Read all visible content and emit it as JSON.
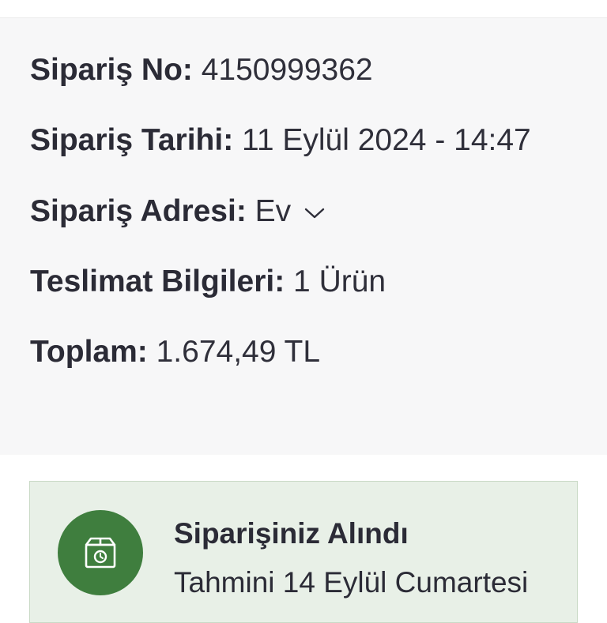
{
  "order": {
    "number_label": "Sipariş No:",
    "number_value": "4150999362",
    "date_label": "Sipariş Tarihi:",
    "date_value": "11 Eylül 2024 - 14:47",
    "address_label": "Sipariş Adresi:",
    "address_value": "Ev",
    "delivery_label": "Teslimat Bilgileri:",
    "delivery_value": "1 Ürün",
    "total_label": "Toplam:",
    "total_value": "1.674,49 TL"
  },
  "status": {
    "title": "Siparişiniz Alındı",
    "subtitle": "Tahmini 14 Eylül Cumartesi",
    "icon": "box-clock-icon",
    "accent_color": "#3f7e3e",
    "card_color": "#e8f0e7"
  },
  "icons": {
    "address_dropdown": "chevron-down-icon"
  }
}
